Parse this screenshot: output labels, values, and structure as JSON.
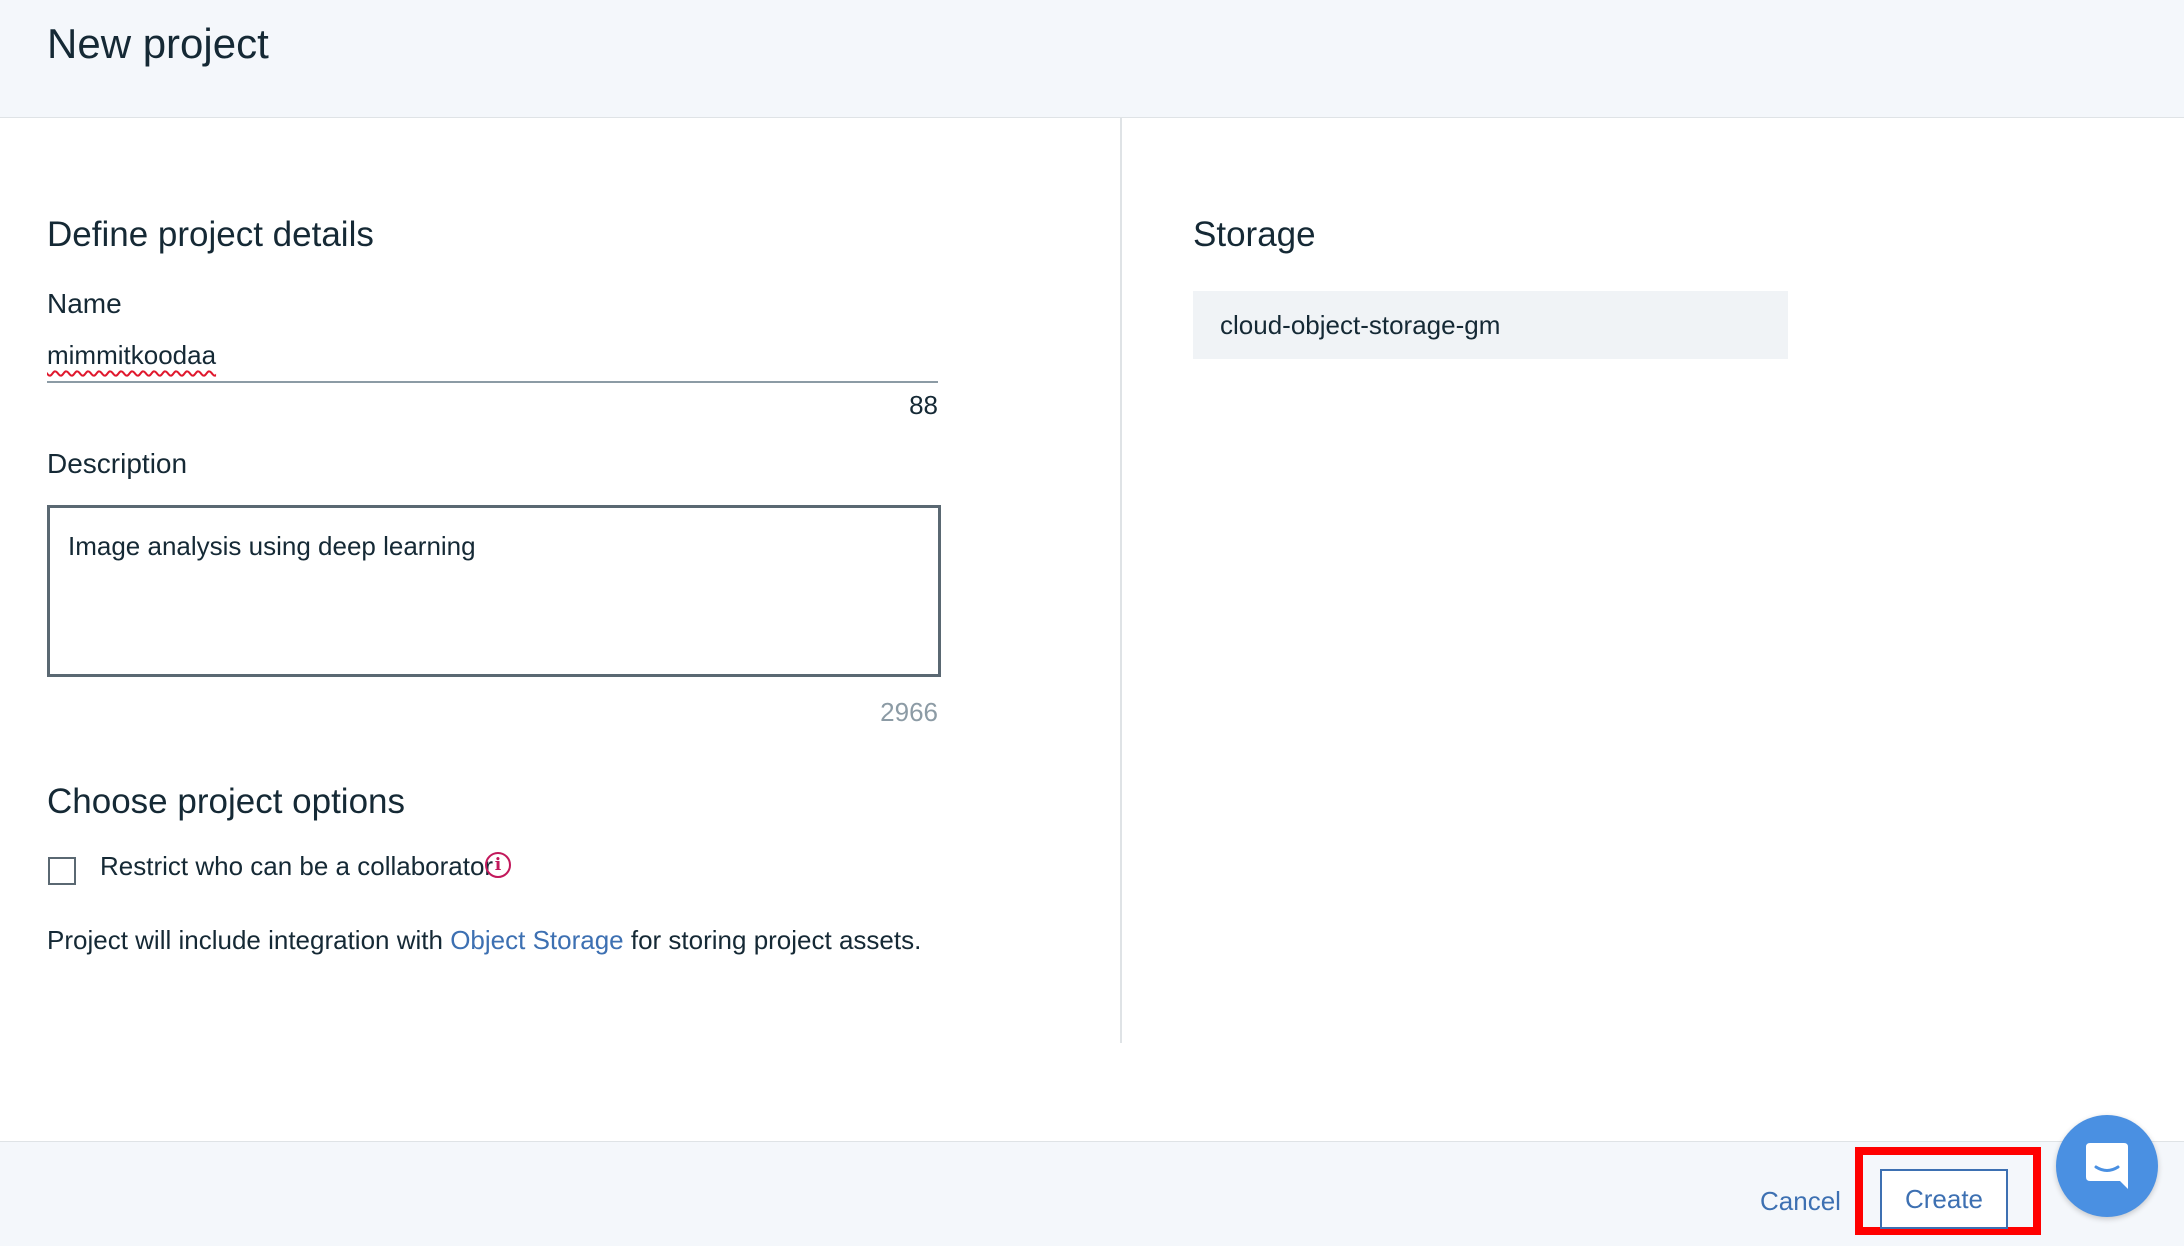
{
  "header": {
    "title": "New project"
  },
  "details": {
    "title": "Define project details",
    "name_label": "Name",
    "name_value": "mimmitkoodaa",
    "name_counter": "88",
    "description_label": "Description",
    "description_value": "Image analysis using deep learning",
    "description_counter": "2966"
  },
  "options": {
    "title": "Choose project options",
    "restrict_label": "Restrict who can be a collaborator",
    "restrict_checked": false,
    "integration_prefix": "Project will include integration with ",
    "integration_link": "Object Storage",
    "integration_suffix": " for storing project assets."
  },
  "storage": {
    "title": "Storage",
    "value": "cloud-object-storage-gm"
  },
  "footer": {
    "cancel_label": "Cancel",
    "create_label": "Create"
  },
  "icons": {
    "info": "info-icon",
    "chat": "chat-bubble-icon"
  },
  "colors": {
    "accent": "#3d70b2",
    "highlight": "#ff0000",
    "info": "#c2185b",
    "chat": "#4a90e2"
  }
}
